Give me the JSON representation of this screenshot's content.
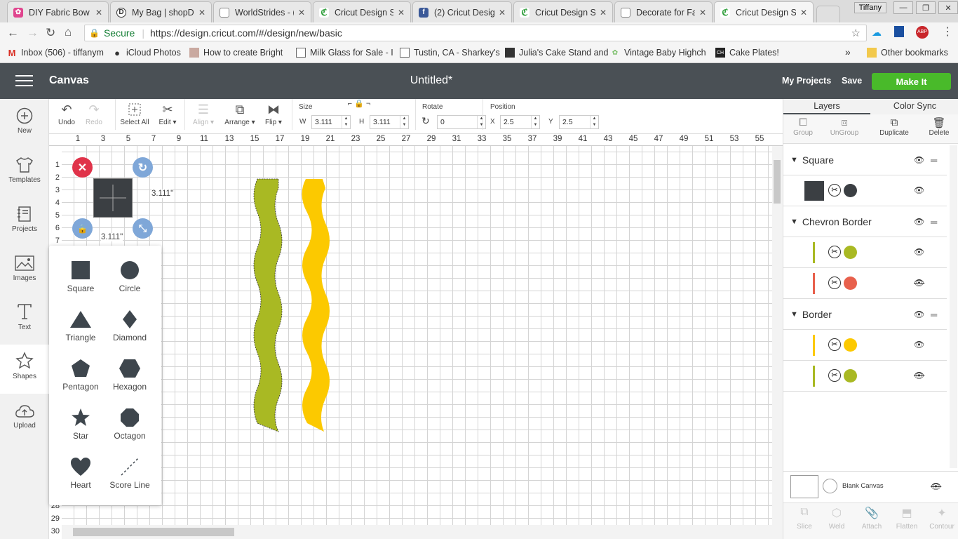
{
  "browser": {
    "tabs": [
      {
        "title": "DIY Fabric Bow",
        "favicon_color": "#e0458e"
      },
      {
        "title": "My Bag | shopD",
        "favicon_color": "#333333"
      },
      {
        "title": "WorldStrides - (",
        "favicon_color": "#888888"
      },
      {
        "title": "Cricut Design S",
        "favicon_color": "#2e9e3a"
      },
      {
        "title": "(2) Cricut Desig",
        "favicon_color": "#3b5998"
      },
      {
        "title": "Cricut Design S",
        "favicon_color": "#2e9e3a"
      },
      {
        "title": "Decorate for Fa",
        "favicon_color": "#888888"
      },
      {
        "title": "Cricut Design S",
        "favicon_color": "#2e9e3a"
      }
    ],
    "user": "Tiffany",
    "secure_label": "Secure",
    "url": "https://design.cricut.com/#/design/new/basic",
    "bookmarks": [
      "Inbox (506) - tiffanym",
      "iCloud Photos",
      "How to create Bright",
      "Milk Glass for Sale - I",
      "Tustin, CA - Sharkey's",
      "Julia's Cake Stand and",
      "Vintage Baby Highch",
      "Cake Plates!"
    ],
    "more_bookmarks": "»",
    "other_bookmarks": "Other bookmarks"
  },
  "app": {
    "title": "Canvas",
    "doc_title": "Untitled*",
    "my_projects": "My Projects",
    "save": "Save",
    "make_it": "Make It",
    "accent": "#49ba2a",
    "header_bg": "#4a5055"
  },
  "leftnav": [
    {
      "label": "New",
      "icon": "plus-circle-icon"
    },
    {
      "label": "Templates",
      "icon": "tshirt-icon"
    },
    {
      "label": "Projects",
      "icon": "projects-icon"
    },
    {
      "label": "Images",
      "icon": "image-icon"
    },
    {
      "label": "Text",
      "icon": "text-icon"
    },
    {
      "label": "Shapes",
      "icon": "shapes-icon"
    },
    {
      "label": "Upload",
      "icon": "upload-cloud-icon"
    }
  ],
  "toolbar": {
    "undo": "Undo",
    "redo": "Redo",
    "select_all": "Select All",
    "edit": "Edit",
    "align": "Align",
    "arrange": "Arrange",
    "flip": "Flip",
    "size_label": "Size",
    "w_label": "W",
    "w_value": "3.111",
    "h_label": "H",
    "h_value": "3.111",
    "rotate_label": "Rotate",
    "rotate_value": "0",
    "position_label": "Position",
    "x_label": "X",
    "x_value": "2.5",
    "y_label": "Y",
    "y_value": "2.5"
  },
  "ruler": {
    "top": [
      "1",
      "3",
      "5",
      "7",
      "9",
      "11",
      "13",
      "15",
      "17",
      "19",
      "21",
      "23",
      "25",
      "27",
      "29",
      "31",
      "33",
      "35",
      "37",
      "39",
      "41",
      "43",
      "45",
      "47",
      "49",
      "51",
      "53",
      "55"
    ],
    "left": [
      "1",
      "2",
      "3",
      "4",
      "5",
      "6",
      "7",
      "",
      "",
      "",
      "",
      "",
      "",
      "",
      "",
      "",
      "",
      "",
      "",
      "",
      "",
      "",
      "",
      "",
      "",
      "",
      "",
      "28",
      "29",
      "30"
    ]
  },
  "selection": {
    "width_label": "3.111\"",
    "height_label": "3.111\""
  },
  "shapes_panel": [
    {
      "label": "Square",
      "icon": "square-icon"
    },
    {
      "label": "Circle",
      "icon": "circle-icon"
    },
    {
      "label": "Triangle",
      "icon": "triangle-icon"
    },
    {
      "label": "Diamond",
      "icon": "diamond-icon"
    },
    {
      "label": "Pentagon",
      "icon": "pentagon-icon"
    },
    {
      "label": "Hexagon",
      "icon": "hexagon-icon"
    },
    {
      "label": "Star",
      "icon": "star-icon"
    },
    {
      "label": "Octagon",
      "icon": "octagon-icon"
    },
    {
      "label": "Heart",
      "icon": "heart-icon"
    },
    {
      "label": "Score Line",
      "icon": "score-line-icon"
    }
  ],
  "canvas_shapes": {
    "green_color": "#a9b923",
    "yellow_color": "#fcc900"
  },
  "layers_panel": {
    "tab_layers": "Layers",
    "tab_color_sync": "Color Sync",
    "actions": [
      "Group",
      "UnGroup",
      "Duplicate",
      "Delete"
    ],
    "groups": [
      {
        "name": "Square",
        "layers": [
          {
            "color": "#3b3f43",
            "visible": true
          }
        ]
      },
      {
        "name": "Chevron Border",
        "layers": [
          {
            "color": "#a9b923",
            "visible": true
          },
          {
            "color": "#e8604c",
            "visible": false
          }
        ]
      },
      {
        "name": "Border",
        "layers": [
          {
            "color": "#fcc900",
            "visible": true
          },
          {
            "color": "#a9b923",
            "visible": false
          }
        ]
      }
    ],
    "blank_canvas": "Blank Canvas",
    "bottom_actions": [
      "Slice",
      "Weld",
      "Attach",
      "Flatten",
      "Contour"
    ]
  }
}
